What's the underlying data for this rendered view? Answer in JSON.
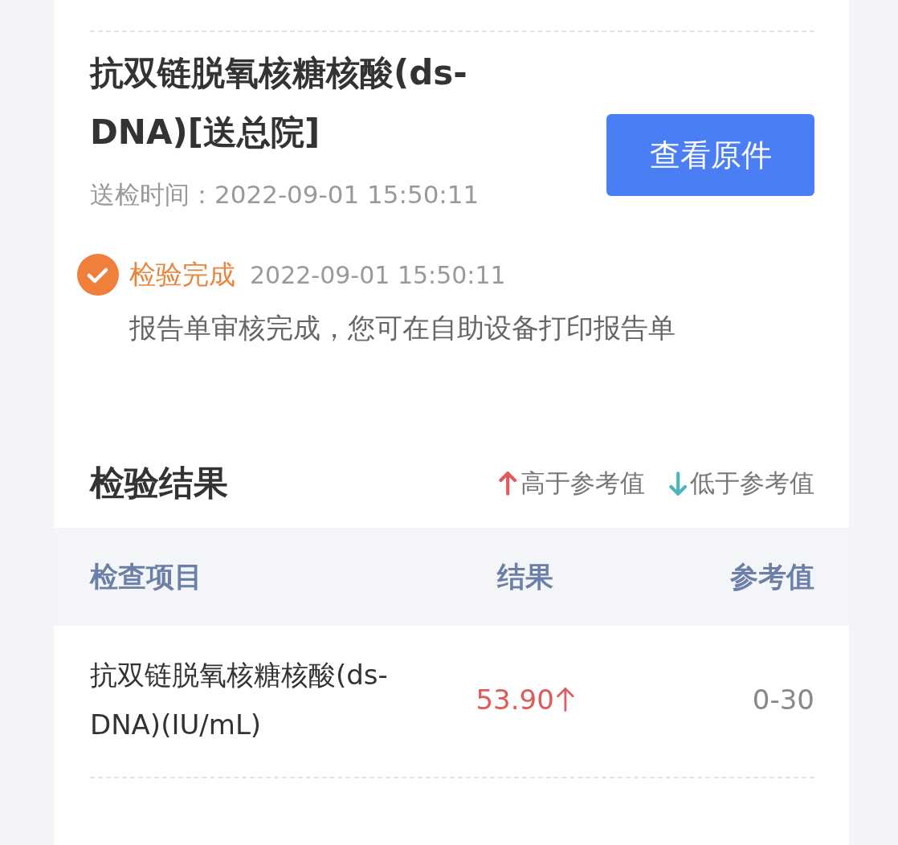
{
  "report": {
    "title": "抗双链脱氧核糖核酸(ds-DNA)[送总院]",
    "button": "查看原件",
    "sent_time_label": "送检时间：",
    "sent_time": "2022-09-01 15:50:11"
  },
  "timeline": [
    {
      "status": "检验完成",
      "time": "2022-09-01 15:50:11",
      "message": "报告单审核完成，您可在自助设备打印报告单",
      "done": true
    }
  ],
  "results": {
    "title": "检验结果",
    "legend": [
      {
        "kind": "high",
        "label": "高于参考值"
      },
      {
        "kind": "low",
        "label": "低于参考值"
      }
    ],
    "columns": [
      "检查项目",
      "结果",
      "参考值"
    ],
    "rows": [
      {
        "item": "抗双链脱氧核糖核酸(ds-DNA)(IU/mL)",
        "result": "53.90",
        "kind": "high",
        "reference": "0-30"
      }
    ]
  }
}
